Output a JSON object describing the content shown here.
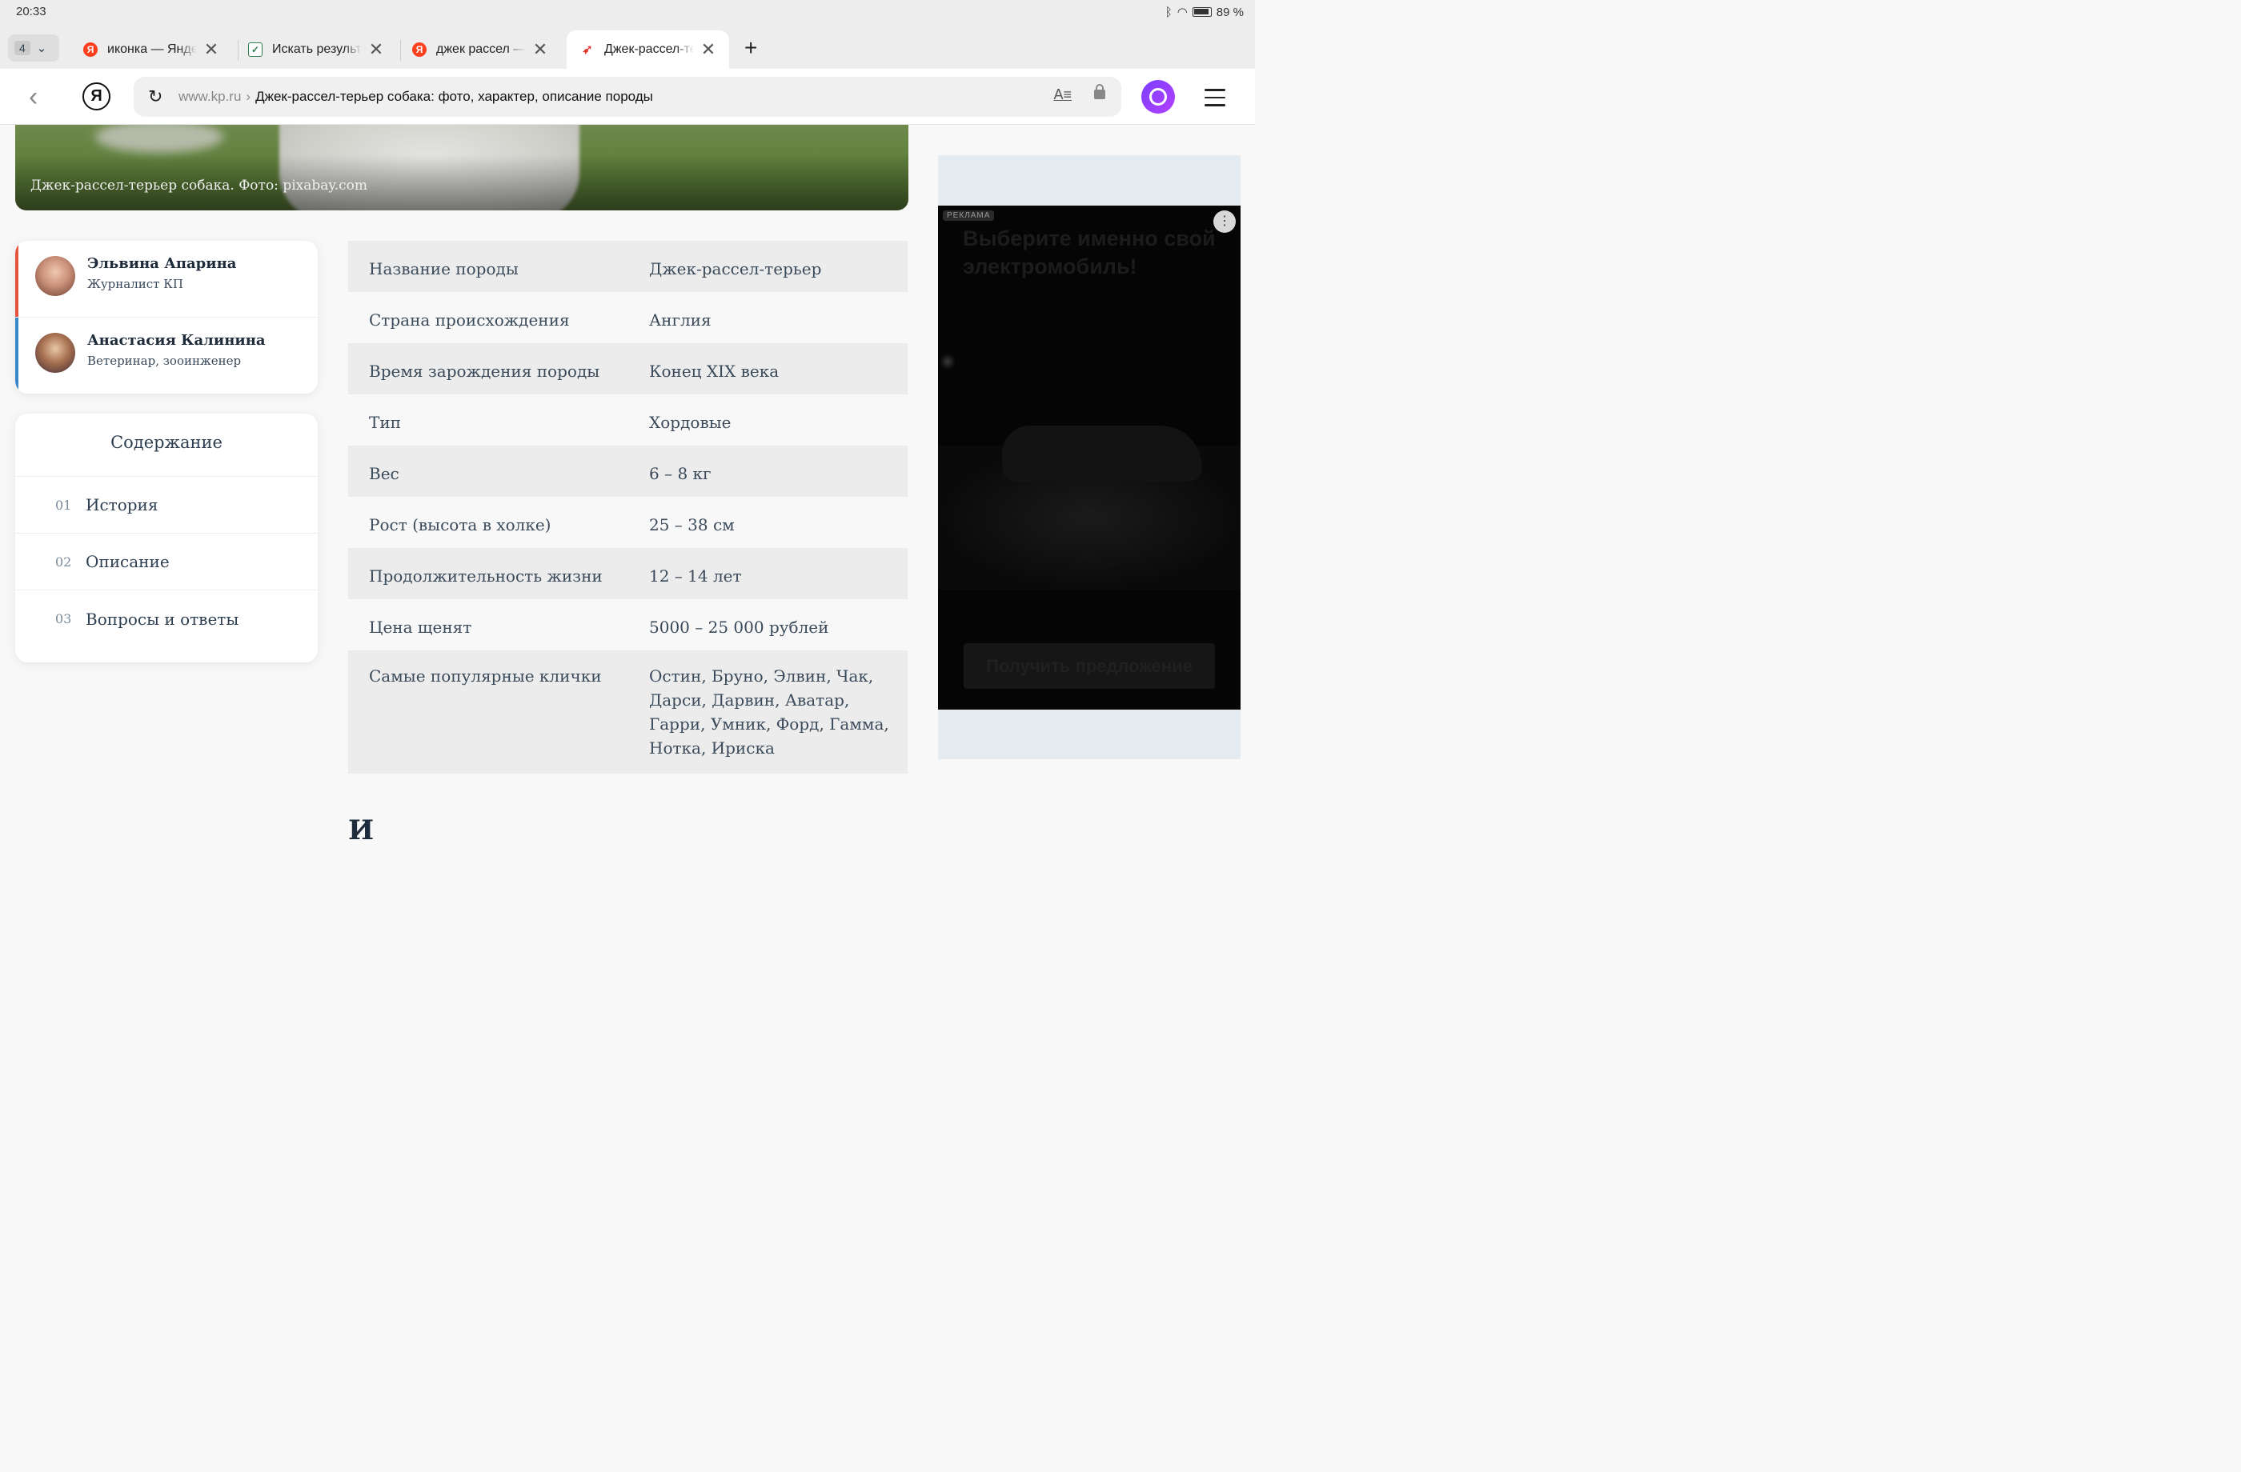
{
  "status_bar": {
    "time": "20:33",
    "battery": "89 %"
  },
  "tabs": {
    "count": "4",
    "items": [
      {
        "title": "иконка — Яндекс",
        "favicon": "Я",
        "favicon_color": "#fc3f1d"
      },
      {
        "title": "Искать результаты",
        "favicon": "✓",
        "favicon_color": "#2e7d4f"
      },
      {
        "title": "джек рассел — Яндекс",
        "favicon": "Я",
        "favicon_color": "#fc3f1d"
      },
      {
        "title": "Джек-рассел-терьер",
        "favicon": "➶",
        "favicon_color": "#e53935"
      }
    ],
    "new_tab": "+"
  },
  "address_bar": {
    "domain": "www.kp.ru",
    "separator": "›",
    "title": "Джек-рассел-терьер собака: фото, характер, описание породы",
    "reader_icon": "A≡"
  },
  "hero": {
    "caption": "Джек-рассел-терьер собака. Фото: pixabay.com"
  },
  "authors": [
    {
      "name": "Эльвина Апарина",
      "role": "Журналист КП",
      "accent": "#e5533d"
    },
    {
      "name": "Анастасия Калинина",
      "role": "Ветеринар, зооинженер",
      "accent": "#3a87c8"
    }
  ],
  "toc": {
    "title": "Содержание",
    "items": [
      {
        "num": "01",
        "label": "История"
      },
      {
        "num": "02",
        "label": "Описание"
      },
      {
        "num": "03",
        "label": "Вопросы и ответы"
      }
    ]
  },
  "breed_table": [
    {
      "key": "Название породы",
      "value": "Джек-рассел-терьер"
    },
    {
      "key": "Страна происхождения",
      "value": "Англия"
    },
    {
      "key": "Время зарождения породы",
      "value": "Конец XIX века"
    },
    {
      "key": "Тип",
      "value": "Хордовые"
    },
    {
      "key": "Вес",
      "value": "6 – 8 кг"
    },
    {
      "key": "Рост (высота в холке)",
      "value": "25 – 38 см"
    },
    {
      "key": "Продолжительность жизни",
      "value": "12 – 14 лет"
    },
    {
      "key": "Цена щенят",
      "value": "5000 – 25 000 рублей"
    },
    {
      "key": "Самые популярные клички",
      "value": "Остин, Бруно, Элвин, Чак, Дарси, Дарвин, Аватар, Гарри, Умник, Форд, Гамма, Нотка, Ириска"
    }
  ],
  "cut_heading": "И",
  "ad": {
    "badge": "РЕКЛАМА",
    "menu": "⋮",
    "headline": "Выберите именно свой электромобиль!",
    "cta": "Получить предложение"
  }
}
